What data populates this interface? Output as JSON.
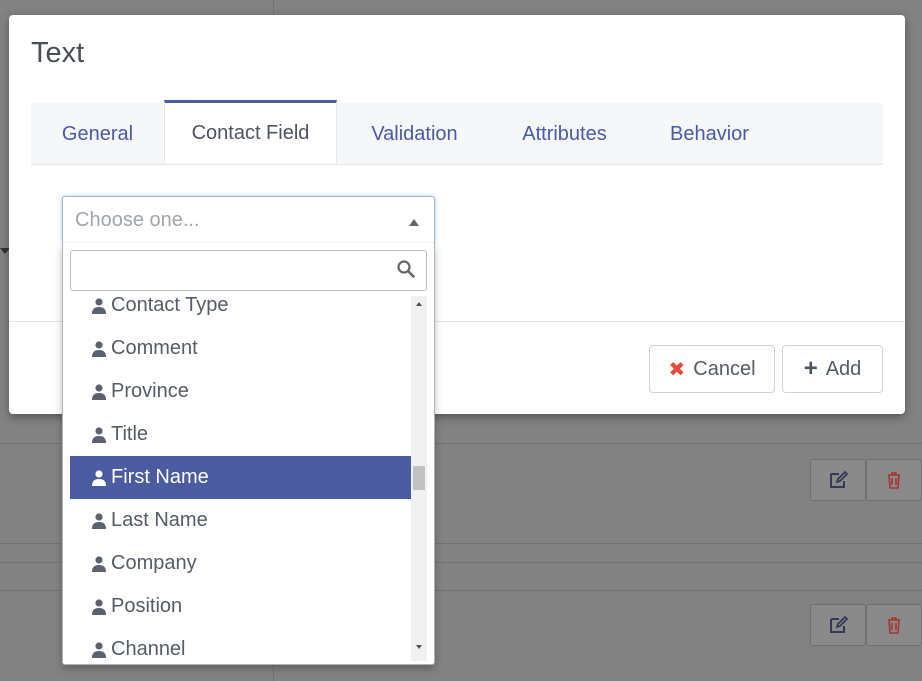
{
  "modal": {
    "title": "Text",
    "tabs": [
      {
        "label": "General"
      },
      {
        "label": "Contact Field"
      },
      {
        "label": "Validation"
      },
      {
        "label": "Attributes"
      },
      {
        "label": "Behavior"
      }
    ],
    "active_tab": "Contact Field",
    "cancel_label": "Cancel",
    "add_label": "Add"
  },
  "select": {
    "placeholder": "Choose one...",
    "search_value": "",
    "options": [
      {
        "label": "Contact Type"
      },
      {
        "label": "Comment"
      },
      {
        "label": "Province"
      },
      {
        "label": "Title"
      },
      {
        "label": "First Name"
      },
      {
        "label": "Last Name"
      },
      {
        "label": "Company"
      },
      {
        "label": "Position"
      },
      {
        "label": "Channel"
      }
    ],
    "highlighted": "First Name"
  },
  "icons": {
    "option_icon": "user-icon",
    "search": "search-icon",
    "cancel": "close-icon",
    "add": "plus-icon",
    "row_edit": "edit-icon",
    "row_delete": "trash-icon"
  },
  "colors": {
    "accent": "#4b5b9f",
    "tab_text": "#4a5aa4",
    "danger": "#e64a3b",
    "overlay": "#828282"
  }
}
